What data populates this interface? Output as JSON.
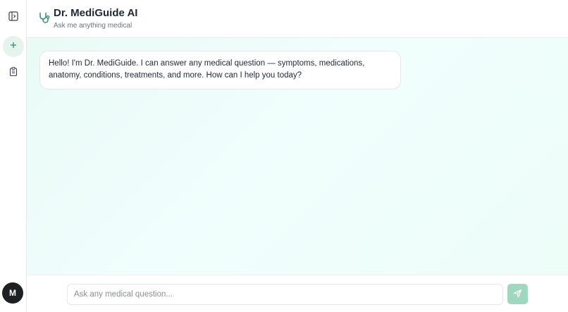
{
  "app": {
    "title": "Dr. MediGuide AI",
    "subtitle": "Ask me anything medical",
    "accent_color": "#2f8f6f"
  },
  "rail": {
    "items": [
      {
        "icon": "sidebar-toggle-icon"
      },
      {
        "icon": "plus-icon"
      },
      {
        "icon": "clipboard-icon"
      }
    ],
    "avatar_initial": "M"
  },
  "messages": [
    {
      "role": "assistant",
      "text": "Hello! I'm Dr. MediGuide. I can answer any medical question — symptoms, medications, anatomy, conditions, treatments, and more. How can I help you today?"
    }
  ],
  "composer": {
    "placeholder": "Ask any medical question...",
    "value": "",
    "send_icon": "send-icon"
  }
}
